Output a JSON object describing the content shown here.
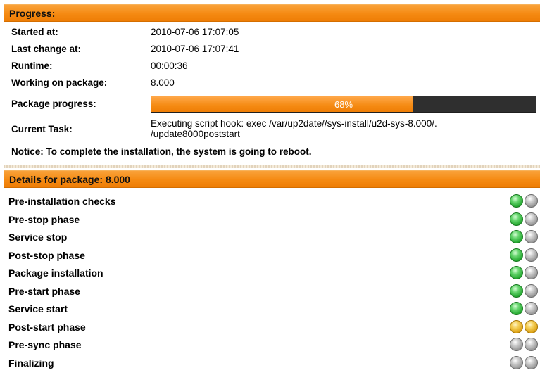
{
  "progress": {
    "header": "Progress:",
    "started_label": "Started at:",
    "started_value": "2010-07-06 17:07:05",
    "last_change_label": "Last change at:",
    "last_change_value": "2010-07-06 17:07:41",
    "runtime_label": "Runtime:",
    "runtime_value": "00:00:36",
    "working_label": "Working on package:",
    "working_value": "8.000",
    "package_progress_label": "Package progress:",
    "package_progress_percent": 68,
    "package_progress_text": "68%",
    "current_task_label": "Current Task:",
    "current_task_line1": "Executing script hook: exec /var/up2date//sys-install/u2d-sys-8.000/.",
    "current_task_line2": "/update8000poststart",
    "notice": "Notice: To complete the installation, the system is going to reboot."
  },
  "details": {
    "header": "Details for package: 8.000",
    "steps": [
      {
        "label": "Pre-installation checks",
        "status": [
          "green",
          "gray"
        ]
      },
      {
        "label": "Pre-stop phase",
        "status": [
          "green",
          "gray"
        ]
      },
      {
        "label": "Service stop",
        "status": [
          "green",
          "gray"
        ]
      },
      {
        "label": "Post-stop phase",
        "status": [
          "green",
          "gray"
        ]
      },
      {
        "label": "Package installation",
        "status": [
          "green",
          "gray"
        ]
      },
      {
        "label": "Pre-start phase",
        "status": [
          "green",
          "gray"
        ]
      },
      {
        "label": "Service start",
        "status": [
          "green",
          "gray"
        ]
      },
      {
        "label": "Post-start phase",
        "status": [
          "amber",
          "amber"
        ]
      },
      {
        "label": "Pre-sync phase",
        "status": [
          "gray",
          "gray"
        ]
      },
      {
        "label": "Finalizing",
        "status": [
          "gray",
          "gray"
        ]
      }
    ]
  },
  "colors": {
    "header_orange": "#f58a12",
    "bar_fill": "#f58a12",
    "bar_track": "#2f2f2f",
    "status_done": "#22a62e",
    "status_active": "#d99c10",
    "status_pending": "#8d8d8d"
  }
}
